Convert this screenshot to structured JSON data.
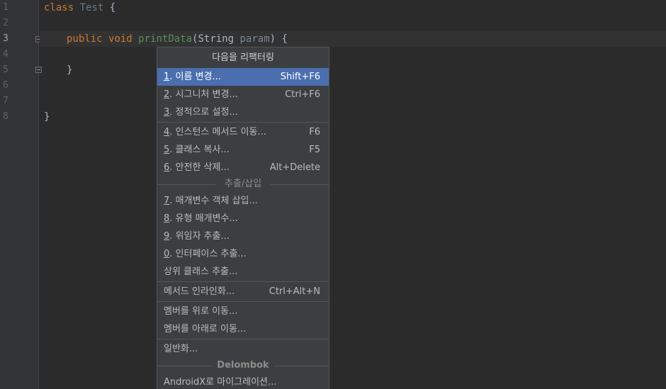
{
  "editor": {
    "line_numbers": [
      "1",
      "2",
      "3",
      "4",
      "5",
      "6",
      "7",
      "8"
    ],
    "code": {
      "line1": {
        "kw": "class",
        "name": "Test",
        "brace": "{"
      },
      "line3": {
        "kw1": "public",
        "kw2": "void",
        "method": "printData",
        "open": "(",
        "type": "String",
        "param": "param",
        "close": ")",
        "brace": "{"
      },
      "line5": {
        "brace": "}"
      },
      "line8": {
        "brace": "}"
      }
    }
  },
  "menu": {
    "title": "다음을 리팩터링",
    "items": [
      {
        "mnemonic": "1",
        "label": ". 이름 변경...",
        "shortcut": "Shift+F6",
        "selected": true
      },
      {
        "mnemonic": "2",
        "label": ". 시그니처 변경...",
        "shortcut": "Ctrl+F6"
      },
      {
        "mnemonic": "3",
        "label": ". 정적으로 설정...",
        "shortcut": ""
      },
      {
        "mnemonic": "4",
        "label": ". 인스턴스 메서드 이동...",
        "shortcut": "F6"
      },
      {
        "mnemonic": "5",
        "label": ". 클래스 복사...",
        "shortcut": "F5"
      },
      {
        "mnemonic": "6",
        "label": ". 안전한 삭제...",
        "shortcut": "Alt+Delete"
      },
      {
        "mnemonic": "7",
        "label": ". 매개변수 객체 삽입...",
        "shortcut": ""
      },
      {
        "mnemonic": "8",
        "label": ". 유형 매개변수...",
        "shortcut": ""
      },
      {
        "mnemonic": "9",
        "label": ". 위임자 추출...",
        "shortcut": ""
      },
      {
        "mnemonic": "0",
        "label": ". 인터페이스 추출...",
        "shortcut": ""
      },
      {
        "mnemonic": "",
        "label": "상위 클래스 추출...",
        "shortcut": ""
      },
      {
        "mnemonic": "",
        "label": "메서드 인라인화...",
        "shortcut": "Ctrl+Alt+N"
      },
      {
        "mnemonic": "",
        "label": "멤버를 위로 이동...",
        "shortcut": ""
      },
      {
        "mnemonic": "",
        "label": "멤버를 아래로 이동...",
        "shortcut": ""
      },
      {
        "mnemonic": "",
        "label": "일반화...",
        "shortcut": ""
      },
      {
        "mnemonic": "",
        "label": "AndroidX로 마이그레이션...",
        "shortcut": ""
      }
    ],
    "group_extract": "추출/삽입",
    "group_delombok": "Delombok"
  },
  "colors": {
    "background": "#2b2b2b",
    "gutter": "#313335",
    "menu_bg": "#3c3f41",
    "selection": "#4b6eaf",
    "keyword": "#cc7832"
  }
}
